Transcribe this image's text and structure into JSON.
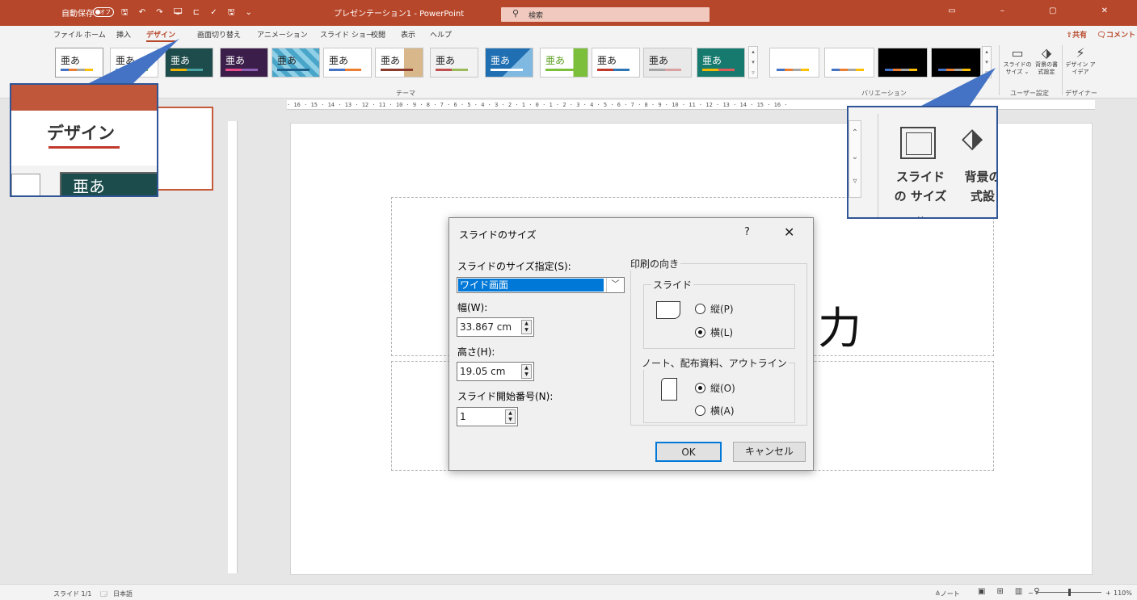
{
  "titlebar": {
    "autosave": "自動保存",
    "autosave_state": "オフ",
    "doc_title": "プレゼンテーション1 - PowerPoint",
    "search": "検索",
    "quick_icons": "🖫 ↶ ↷ 🖵 ⊏ ✓ 🖫 ⌄"
  },
  "menu": {
    "tabs": [
      "ファイル",
      "ホーム",
      "挿入",
      "デザイン",
      "画面切り替え",
      "アニメーション",
      "スライド ショー",
      "校閲",
      "表示",
      "ヘルプ"
    ],
    "active_tab": "デザイン",
    "share": "共有",
    "comment": "コメント"
  },
  "ribbon": {
    "theme_label": "亜あ",
    "group_themes": "テーマ",
    "group_variants": "バリエーション",
    "group_user": "ユーザー設定",
    "group_designer": "デザイナー",
    "btn_slide_size": "スライドの サイズ ⌄",
    "btn_format_bg": "背景の書 式設定",
    "btn_design_ideas": "デザイン アイデア",
    "colors": {
      "accent": "#b7472a"
    }
  },
  "callouts": {
    "left_text": "デザイン",
    "left_thumb_text": "亜あ",
    "right_label1": "スライドの サイズ ⌄",
    "right_label2": "背景の 式設"
  },
  "slide": {
    "title_fragment": "力"
  },
  "dialog": {
    "title": "スライドのサイズ",
    "help": "?",
    "close": "✕",
    "size_label": "スライドのサイズ指定(S):",
    "size_value": "ワイド画面",
    "width_label": "幅(W):",
    "width_value": "33.867 cm",
    "height_label": "高さ(H):",
    "height_value": "19.05 cm",
    "start_label": "スライド開始番号(N):",
    "start_value": "1",
    "orientation_label": "印刷の向き",
    "slides_group": "スライド",
    "slides_portrait": "縦(P)",
    "slides_landscape": "横(L)",
    "notes_group": "ノート、配布資料、アウトライン",
    "notes_portrait": "縦(O)",
    "notes_landscape": "横(A)",
    "ok": "OK",
    "cancel": "キャンセル"
  },
  "statusbar": {
    "slide_count": "スライド 1/1",
    "language": "日本語",
    "notes": "≙ノート",
    "zoom": "110%",
    "zoom_fraction": 0.5
  }
}
